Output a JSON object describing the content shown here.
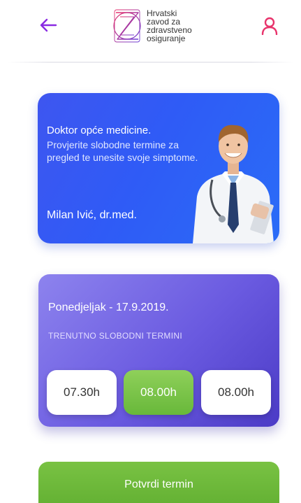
{
  "header": {
    "logo_lines": [
      "Hrvatski",
      "zavod za",
      "zdravstveno",
      "osiguranje"
    ],
    "accent_color": "#8a2be2",
    "profile_color": "#e8336b"
  },
  "doctor_card": {
    "title": "Doktor opće medicine.",
    "description": "Provjerite slobodne termine za pregled te unesite svoje simptome.",
    "name": "Milan Ivić, dr.med."
  },
  "appointment": {
    "date": "Ponedjeljak - 17.9.2019.",
    "subtitle": "TRENUTNO SLOBODNI TERMINI",
    "slots": [
      {
        "label": "07.30h",
        "selected": false
      },
      {
        "label": "08.00h",
        "selected": true
      },
      {
        "label": "08.00h",
        "selected": false
      }
    ]
  },
  "confirm_button": {
    "label": "Potvrdi termin"
  },
  "colors": {
    "doctor_card": "#2f5bf6",
    "appointment_card": "#6a5ae0",
    "green": "#72bb3c"
  }
}
